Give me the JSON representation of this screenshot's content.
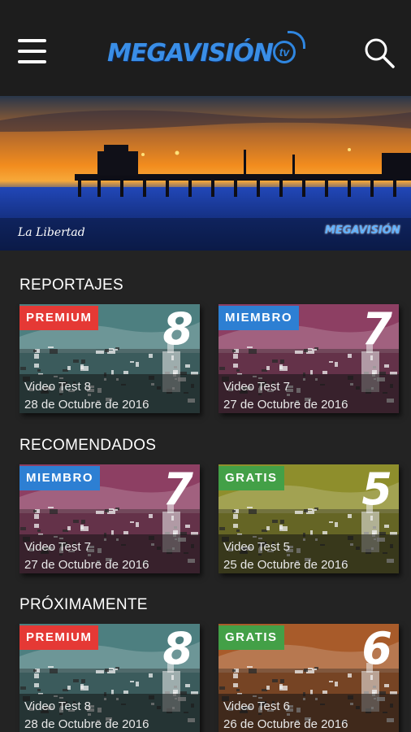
{
  "header": {
    "logo_text": "MEGAVISIÓN",
    "logo_tv": "tv"
  },
  "banner": {
    "caption": "La Libertad",
    "watermark": "MEGAVISIÓN"
  },
  "sections": [
    {
      "title": "REPORTAJES",
      "cards": [
        {
          "tag": "PREMIUM",
          "tag_color": "#e53935",
          "number": "8",
          "tint": "#4d7f80",
          "title": "Video Test 8",
          "date": "28 de Octubre de 2016"
        },
        {
          "tag": "MIEMBRO",
          "tag_color": "#2d7fd3",
          "number": "7",
          "tint": "#8d3f63",
          "title": "Video Test 7",
          "date": "27 de Octubre de 2016"
        }
      ]
    },
    {
      "title": "RECOMENDADOS",
      "cards": [
        {
          "tag": "MIEMBRO",
          "tag_color": "#2d7fd3",
          "number": "7",
          "tint": "#8d3f63",
          "title": "Video Test 7",
          "date": "27 de Octubre de 2016"
        },
        {
          "tag": "GRATIS",
          "tag_color": "#43a047",
          "number": "5",
          "tint": "#8e8e2c",
          "title": "Video Test 5",
          "date": "25 de Octubre de 2016"
        }
      ]
    },
    {
      "title": "PRÓXIMAMENTE",
      "cards": [
        {
          "tag": "PREMIUM",
          "tag_color": "#e53935",
          "number": "8",
          "tint": "#4d7f80",
          "title": "Video Test 8",
          "date": "28 de Octubre de 2016"
        },
        {
          "tag": "GRATIS",
          "tag_color": "#43a047",
          "number": "6",
          "tint": "#a85b2a",
          "title": "Video Test 6",
          "date": "26 de Octubre de 2016"
        }
      ]
    }
  ]
}
